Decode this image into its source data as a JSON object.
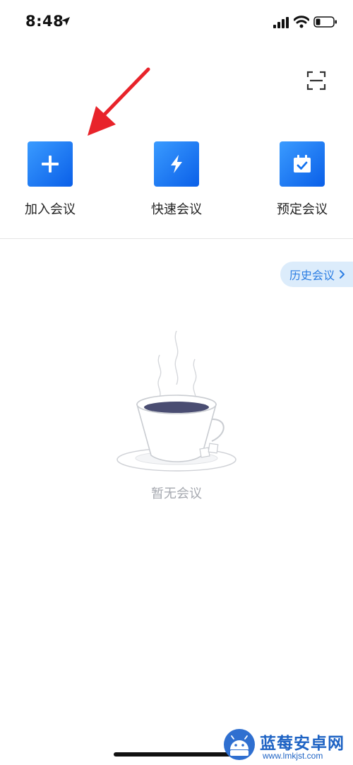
{
  "status_bar": {
    "time": "8:48",
    "icons": [
      "location-arrow-icon",
      "signal-icon",
      "wifi-icon",
      "battery-icon"
    ]
  },
  "header": {
    "scan_icon": "scan-icon"
  },
  "actions": [
    {
      "label": "加入会议",
      "icon": "plus-icon"
    },
    {
      "label": "快速会议",
      "icon": "lightning-icon"
    },
    {
      "label": "预定会议",
      "icon": "calendar-check-icon"
    }
  ],
  "history": {
    "label": "历史会议",
    "icon": "chevron-right-icon"
  },
  "empty_state": {
    "illustration": "coffee-cup-illustration",
    "text": "暂无会议"
  },
  "watermark": {
    "title": "蓝莓安卓网",
    "url": "www.lmkjst.com"
  },
  "colors": {
    "accent": "#1473f0",
    "history_bg": "#dcecfb",
    "history_text": "#2b7de3",
    "empty_text": "#a6a9b0",
    "annotation_arrow": "#e8232a",
    "watermark": "#1e63c4"
  }
}
